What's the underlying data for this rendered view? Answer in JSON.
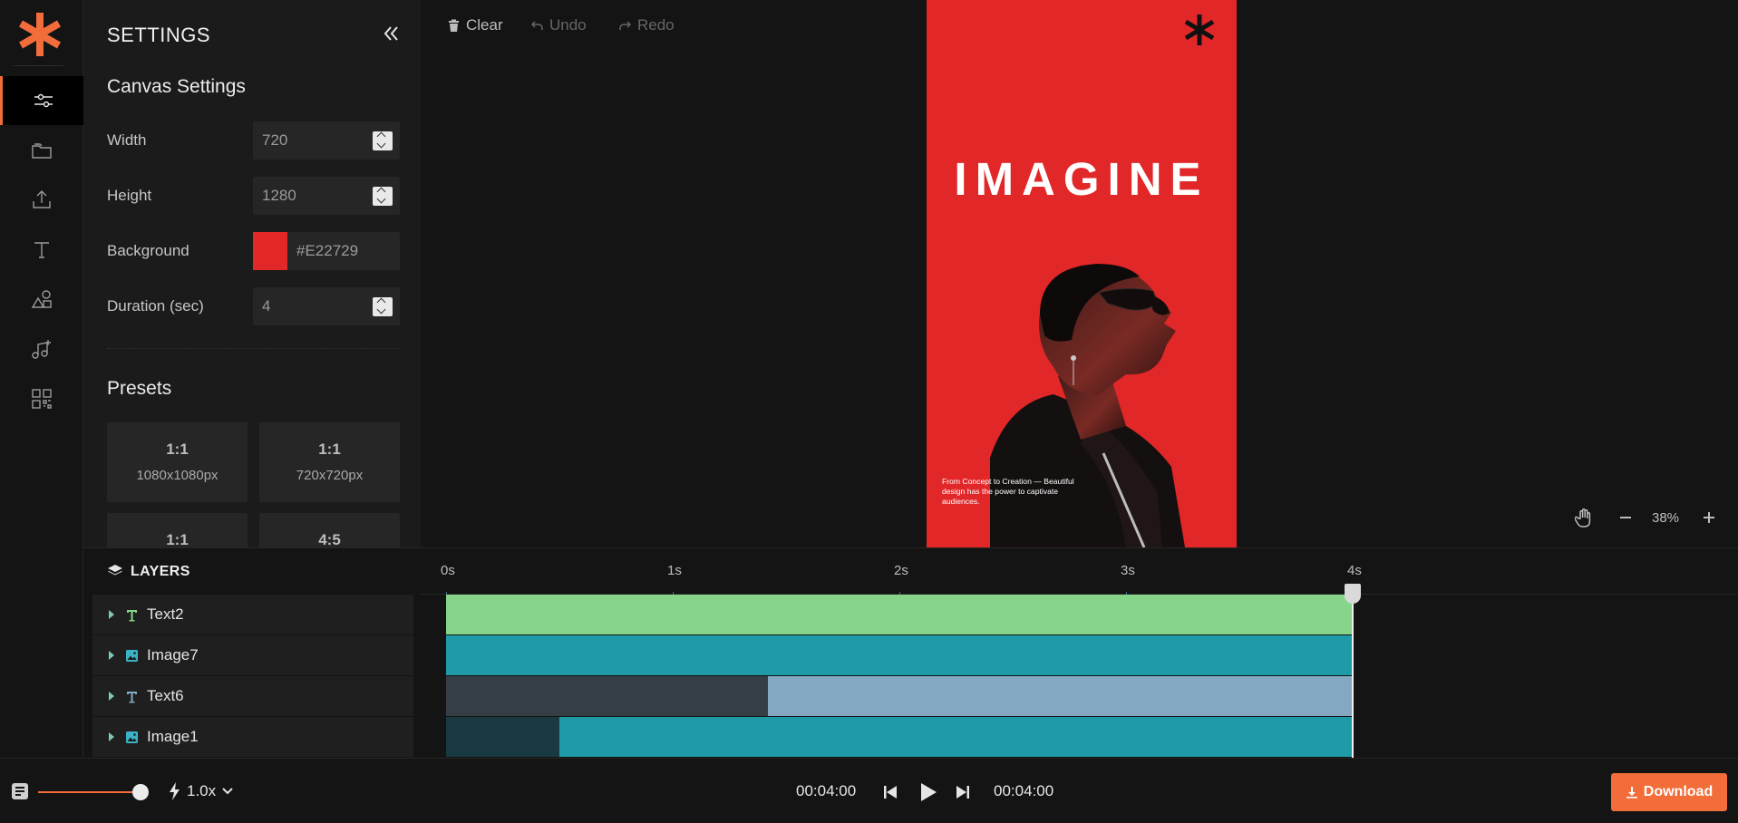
{
  "brand": {
    "accent": "#f26d3a"
  },
  "settings": {
    "title": "SETTINGS",
    "canvas_section": "Canvas Settings",
    "width": {
      "label": "Width",
      "value": "720"
    },
    "height": {
      "label": "Height",
      "value": "1280"
    },
    "background": {
      "label": "Background",
      "value": "#E22729",
      "color": "#e22729"
    },
    "duration": {
      "label": "Duration (sec)",
      "value": "4"
    },
    "presets_section": "Presets",
    "presets": [
      {
        "ratio": "1:1",
        "size": "1080x1080px"
      },
      {
        "ratio": "1:1",
        "size": "720x720px"
      },
      {
        "ratio": "1:1",
        "size": ""
      },
      {
        "ratio": "4:5",
        "size": ""
      }
    ]
  },
  "rail": {
    "items": [
      "settings-icon",
      "folder-icon",
      "upload-icon",
      "text-icon",
      "shapes-icon",
      "music-icon",
      "qr-code-icon"
    ]
  },
  "toolbar": {
    "clear": "Clear",
    "undo": "Undo",
    "redo": "Redo"
  },
  "canvas": {
    "headline": "IMAGINE",
    "caption": "From Concept to Creation — Beautiful design has the power to captivate audiences.",
    "background": "#e22729"
  },
  "zoom": {
    "value": "38%"
  },
  "layers": {
    "title": "LAYERS",
    "items": [
      {
        "name": "Text2",
        "kind": "text"
      },
      {
        "name": "Image7",
        "kind": "image"
      },
      {
        "name": "Text6",
        "kind": "text"
      },
      {
        "name": "Image1",
        "kind": "image"
      }
    ]
  },
  "timeline": {
    "ticks": [
      "0s",
      "1s",
      "2s",
      "3s",
      "4s"
    ],
    "duration_seconds": 4,
    "playhead_seconds": 4,
    "clips": [
      {
        "layer": "Text2",
        "segments": [
          {
            "start": 0,
            "end": 4,
            "color": "#86d58b"
          }
        ]
      },
      {
        "layer": "Image7",
        "segments": [
          {
            "start": 0,
            "end": 4,
            "color": "#1e9aa9"
          }
        ]
      },
      {
        "layer": "Text6",
        "segments": [
          {
            "start": 0,
            "end": 1.42,
            "color": "#363e45"
          },
          {
            "start": 1.42,
            "end": 4,
            "color": "#84a8c2"
          }
        ]
      },
      {
        "layer": "Image1",
        "segments": [
          {
            "start": 0,
            "end": 0.5,
            "color": "#193a41"
          },
          {
            "start": 0.5,
            "end": 4,
            "color": "#1e9aa9"
          }
        ]
      }
    ]
  },
  "player": {
    "current": "00:04:00",
    "total": "00:04:00",
    "speed": "1.0x",
    "volume_fraction": 1.0,
    "download": "Download"
  }
}
